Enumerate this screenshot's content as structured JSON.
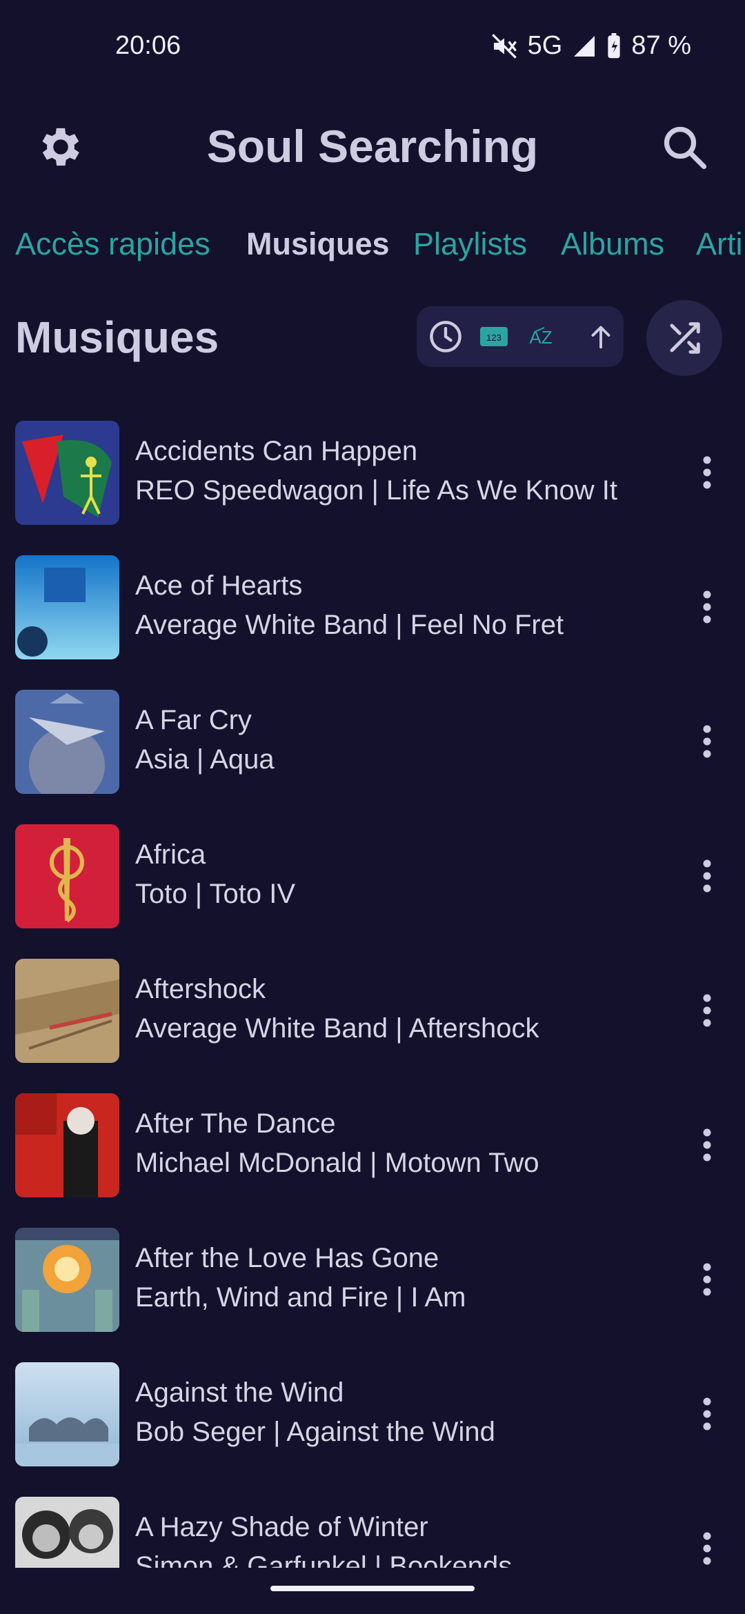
{
  "status": {
    "time": "20:06",
    "network": "5G",
    "battery": "87 %"
  },
  "header": {
    "title": "Soul Searching",
    "settings_icon": "gear-icon",
    "search_icon": "search-icon"
  },
  "tabs": [
    {
      "label": "Accès rapides"
    },
    {
      "label": "Musiques",
      "active": true
    },
    {
      "label": "Playlists"
    },
    {
      "label": "Albums"
    },
    {
      "label": "Arti"
    }
  ],
  "section": {
    "title": "Musiques",
    "sort_buttons": [
      "clock-icon",
      "number-sort-icon",
      "alphabet-sort-icon",
      "arrow-up-icon"
    ],
    "shuffle_icon": "shuffle-icon",
    "accent_color": "#2aa5a1"
  },
  "songs": [
    {
      "title": "Accidents Can Happen",
      "subtitle": "REO Speedwagon | Life As We Know It"
    },
    {
      "title": "Ace of Hearts",
      "subtitle": "Average White Band | Feel No Fret"
    },
    {
      "title": "A Far Cry",
      "subtitle": "Asia | Aqua"
    },
    {
      "title": "Africa",
      "subtitle": "Toto | Toto IV"
    },
    {
      "title": "Aftershock",
      "subtitle": "Average White Band | Aftershock"
    },
    {
      "title": "After The Dance",
      "subtitle": "Michael McDonald | Motown Two"
    },
    {
      "title": "After the Love Has Gone",
      "subtitle": "Earth, Wind and Fire | I Am"
    },
    {
      "title": "Against the Wind",
      "subtitle": "Bob Seger | Against the Wind"
    },
    {
      "title": "A Hazy Shade of Winter",
      "subtitle": "Simon & Garfunkel | Bookends"
    }
  ]
}
